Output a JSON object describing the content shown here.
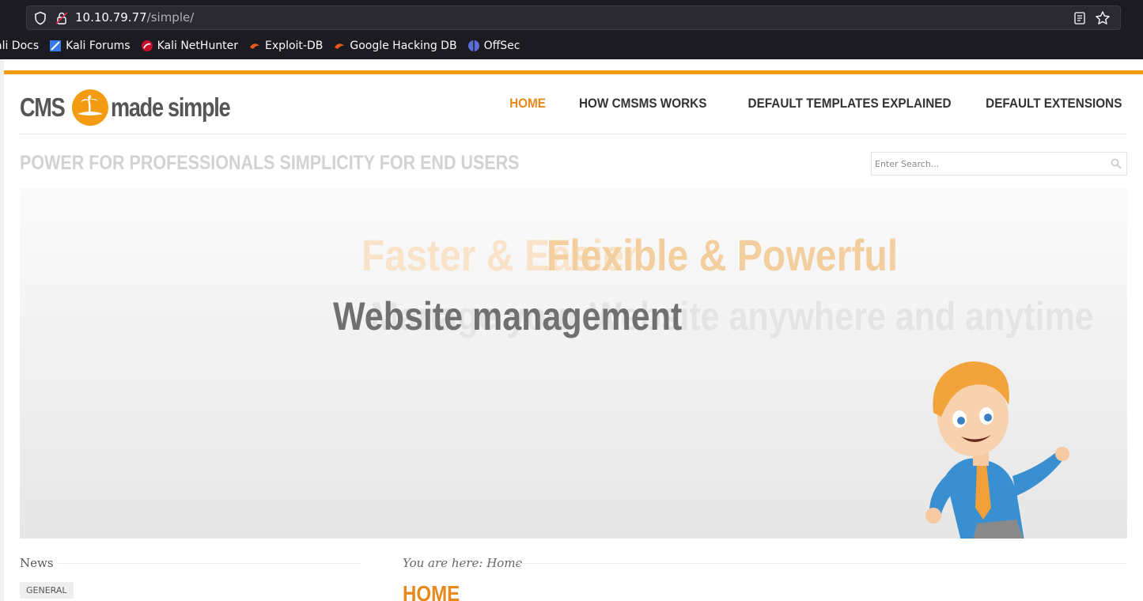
{
  "browser": {
    "url_host": "10.10.79.77",
    "url_path": "/simple/",
    "bookmarks": [
      {
        "label": "ali Docs",
        "icon": "kali-docs-icon"
      },
      {
        "label": "Kali Forums",
        "icon": "kali-forums-icon"
      },
      {
        "label": "Kali NetHunter",
        "icon": "kali-nethunter-icon"
      },
      {
        "label": "Exploit-DB",
        "icon": "exploit-db-icon"
      },
      {
        "label": "Google Hacking DB",
        "icon": "ghdb-icon"
      },
      {
        "label": "OffSec",
        "icon": "offsec-icon"
      }
    ]
  },
  "site": {
    "logo": {
      "left": "CMS",
      "right": "made simple"
    },
    "nav": [
      {
        "label": "HOME",
        "active": true
      },
      {
        "label": "HOW CMSMS WORKS",
        "active": false
      },
      {
        "label": "DEFAULT TEMPLATES EXPLAINED",
        "active": false
      },
      {
        "label": "DEFAULT EXTENSIONS",
        "active": false
      }
    ],
    "tagline": "POWER FOR PROFESSIONALS SIMPLICITY FOR END USERS",
    "search_placeholder": "Enter Search...",
    "hero": {
      "line1_faded": "Faster & Easier",
      "line1": "Flexible & Powerful",
      "line2_faded": "Manage your Website anywhere and anytime",
      "line2": "Website management"
    },
    "sidebar": {
      "news_title": "News",
      "category_tag": "GENERAL"
    },
    "breadcrumb": "You are here: Home",
    "page_title": "HOME"
  },
  "colors": {
    "accent": "#f39c12",
    "nav_active": "#e8891b",
    "browser_bg": "#1c1b22"
  }
}
